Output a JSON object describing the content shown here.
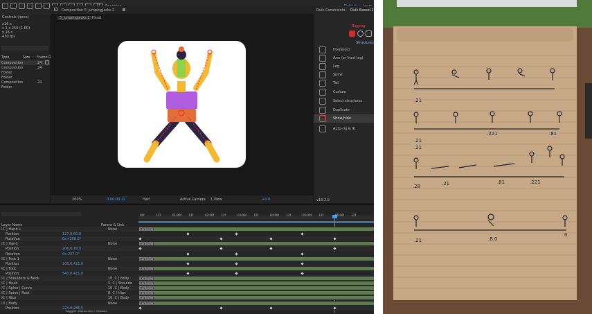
{
  "workspace": {
    "default_label": "Default",
    "learn_label": "Learn"
  },
  "toolbar": {
    "snapping_label": "Snapping"
  },
  "project": {
    "panel_title": "Controls (none)",
    "info_lines": [
      "x16 x",
      "x 1 x 250 (1.00)",
      "x 16 s",
      "430 fps"
    ],
    "headers": {
      "type": "Type",
      "size": "Size",
      "rate": "Frame Ra..."
    },
    "items": [
      {
        "type": "Composition",
        "size": "",
        "rate": "24"
      },
      {
        "type": "Composition",
        "size": "",
        "rate": "24"
      },
      {
        "type": "Folder",
        "size": "",
        "rate": ""
      },
      {
        "type": "Folder",
        "size": "",
        "rate": ""
      },
      {
        "type": "Composition",
        "size": "",
        "rate": "24"
      },
      {
        "type": "Folder",
        "size": "",
        "rate": ""
      }
    ]
  },
  "composition": {
    "title": "Composition 5_jumpingjacks 2",
    "tabs": [
      "5_jumpingjacks 2",
      "Head"
    ],
    "zoom": "200%",
    "timecode": "0:00:00:12",
    "quality": "Half",
    "camera": "Active Camera",
    "view": "1 View",
    "exposure": "+0.0"
  },
  "duik": {
    "tabs": [
      "Duik Constraints",
      "Duik Bassel.2"
    ],
    "section": "Rigging",
    "subsection": "Structures",
    "items": [
      "Hominoid",
      "Arm (or front leg)",
      "Leg",
      "Spine",
      "Tail",
      "Custom",
      "Select structures",
      "Duplicate",
      "Show/hide",
      "Auto-rig & IK"
    ],
    "highlighted": "Show/hide",
    "version": "v16.2.9"
  },
  "timeline": {
    "col_header": "Layer Name",
    "parent_header": "Parent & Link",
    "footer": "Toggle Switches / Modes",
    "ruler": [
      "00f",
      "12f",
      "01:00f",
      "12f",
      "02:00f",
      "12f",
      "03:00f",
      "12f",
      "04:00f",
      "12f",
      "05:00f",
      "12f",
      "06:00f",
      "12f"
    ],
    "layers": [
      {
        "num": "1",
        "name": "C | Hand L",
        "parent": "None",
        "ctrl": true
      },
      {
        "num": "",
        "name": "Position",
        "value": "127.0,60.0"
      },
      {
        "num": "",
        "name": "Rotation",
        "value": "0x+166.0°"
      },
      {
        "num": "2",
        "name": "C | Hand",
        "parent": "None",
        "ctrl": true
      },
      {
        "num": "",
        "name": "Position",
        "value": "206.0,78.0"
      },
      {
        "num": "",
        "name": "Rotation",
        "value": "0x-207.0°"
      },
      {
        "num": "3",
        "name": "C | Foot 1",
        "parent": "None",
        "ctrl": true
      },
      {
        "num": "",
        "name": "Position",
        "value": "106.0,421.0"
      },
      {
        "num": "4",
        "name": "C | Foot",
        "parent": "None",
        "ctrl": true
      },
      {
        "num": "",
        "name": "Position",
        "value": "540.0,421.0"
      },
      {
        "num": "5",
        "name": "C | Shoulders & Neck",
        "parent": "10. C | Body",
        "ctrl": true
      },
      {
        "num": "6",
        "name": "C | Head",
        "parent": "5. C | Shoulde",
        "ctrl": true
      },
      {
        "num": "7",
        "name": "C | Spine | Curve",
        "parent": "10. C | Body",
        "ctrl": true
      },
      {
        "num": "8",
        "name": "C | Spine | Root",
        "parent": "8. C | Hips",
        "ctrl": true
      },
      {
        "num": "9",
        "name": "C | Hips",
        "parent": "10. C | Body",
        "ctrl": true
      },
      {
        "num": "10",
        "name": "C | Body",
        "parent": "None",
        "ctrl": true
      },
      {
        "num": "",
        "name": "Position",
        "value": "224.0,286.5"
      }
    ],
    "controller_label": "Controller"
  },
  "notebook": {
    "marks": [
      ".21",
      ".21",
      ".221",
      ".81",
      ".21",
      ".28",
      ".21",
      ".221",
      ".81",
      ".8.0",
      ".8.0",
      ".21",
      ".21",
      "0"
    ]
  },
  "colors": {
    "accent": "#4a9ae8",
    "highlight": "#3a3a3a",
    "bar": "#5c7c4c",
    "paper": "#c7a886"
  }
}
